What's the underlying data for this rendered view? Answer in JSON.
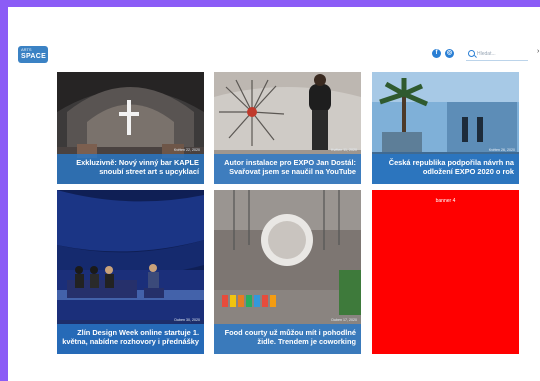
{
  "header": {
    "logo_top": "ARTS",
    "logo_bottom": "SPACE",
    "search_placeholder": "Hledat..."
  },
  "social": {
    "facebook": "f",
    "instagram": "◎"
  },
  "articles": [
    {
      "date": "Květen 22, 2020",
      "title": "Exkluzivně: Nový vinný bar KAPLE snoubí street art s upcyklací"
    },
    {
      "date": "Květen 11, 2020",
      "title": "Autor instalace pro EXPO Jan Dostál: Svařovat jsem se naučil na YouTube"
    },
    {
      "date": "Květen 26, 2020",
      "title": "Česká republika podpořila návrh na odložení EXPO 2020 o rok"
    },
    {
      "date": "Duben 30, 2020",
      "title": "Zlín Design Week online startuje 1. května, nabídne rozhovory i přednášky"
    },
    {
      "date": "Duben 17, 2020",
      "title": "Food courty už můžou mít i pohodlné židle. Trendem je coworking"
    }
  ],
  "banner": {
    "label": "banner 4"
  },
  "colors": {
    "accent": "#2a7fd4",
    "frame": "#8b5cf6",
    "banner": "#ff0000"
  }
}
